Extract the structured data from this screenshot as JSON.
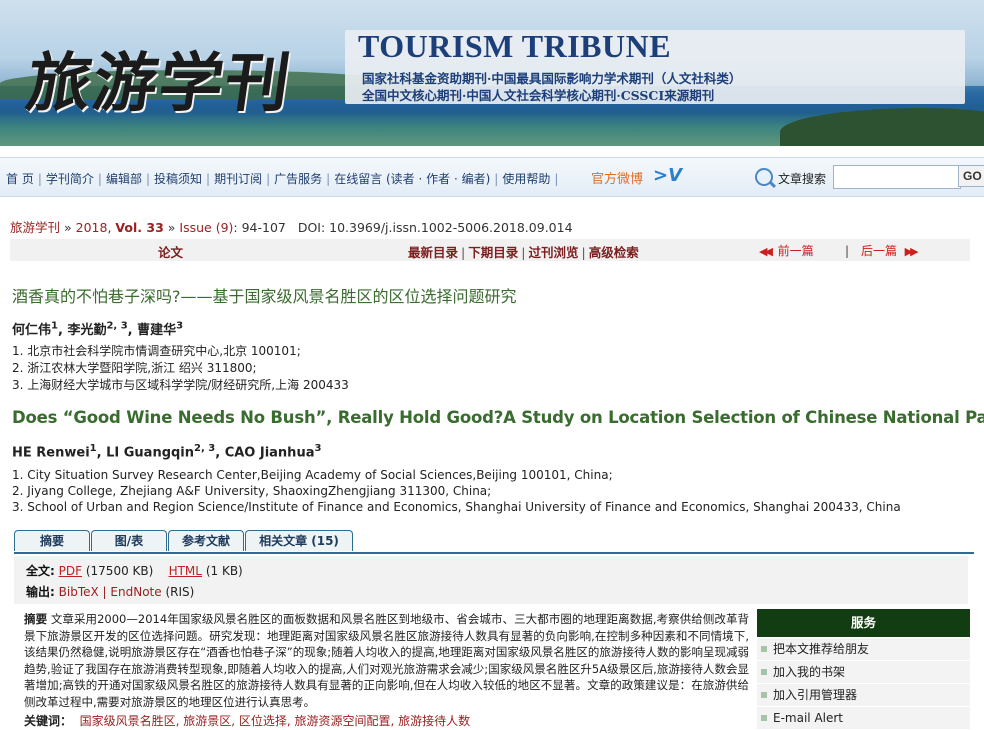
{
  "banner": {
    "calligraphy": "旅游学刊",
    "title_en": "TOURISM TRIBUNE",
    "line1": "国家社科基金资助期刊·中国最具国际影响力学术期刊（人文社科类）",
    "line2": "全国中文核心期刊·中国人文社会科学核心期刊·CSSCI来源期刊"
  },
  "nav": {
    "items": [
      "首 页",
      "学刊简介",
      "编辑部",
      "投稿须知",
      "期刊订阅",
      "广告服务",
      "在线留言 (读者 · 作者 · 编者)",
      "使用帮助"
    ],
    "weibo": "官方微博",
    "search_label": "文章搜索",
    "search_value": "",
    "search_button": "GO"
  },
  "citation": {
    "journal": "旅游学刊",
    "sep": "»",
    "year": "2018",
    "volume": "Vol. 33",
    "issue": "Issue (9)",
    "pages": ": 94-107",
    "doi": "DOI: 10.3969/j.issn.1002-5006.2018.09.014"
  },
  "toolbar": {
    "section": "论文",
    "links": [
      "最新目录",
      "下期目录",
      "过刊浏览",
      "高级检索"
    ],
    "prev": "前一篇",
    "next": "后一篇",
    "divider": "|"
  },
  "article": {
    "title_cn": "酒香真的不怕巷子深吗?——基于国家级风景名胜区的区位选择问题研究",
    "authors_cn": [
      {
        "name": "何仁伟",
        "sup": "1"
      },
      {
        "name": "李光勤",
        "sup": "2, 3"
      },
      {
        "name": "曹建华",
        "sup": "3"
      }
    ],
    "aff_cn": [
      "1. 北京市社会科学院市情调查研究中心,北京  100101;",
      "2. 浙江农林大学暨阳学院,浙江  绍兴  311800;",
      "3. 上海财经大学城市与区域科学学院/财经研究所,上海  200433"
    ],
    "title_en": "Does “Good Wine Needs No Bush”, Really Hold Good?A Study on Location Selection of Chinese National Parks",
    "authors_en": [
      {
        "name": "HE Renwei",
        "sup": "1"
      },
      {
        "name": "LI Guangqin",
        "sup": "2, 3"
      },
      {
        "name": "CAO Jianhua",
        "sup": "3"
      }
    ],
    "aff_en": [
      "1. City Situation Survey Research Center,Beijing Academy of Social Sciences,Beijing 100101, China;",
      "2. Jiyang College, Zhejiang A&F University, ShaoxingZhengjiang 311300, China;",
      "3. School of Urban and Region Science/Institute of Finance and Economics, Shanghai University of Finance and Economics, Shanghai 200433, China"
    ]
  },
  "tabs": [
    "摘要",
    "图/表",
    "参考文献",
    "相关文章 (15)"
  ],
  "fulltext": {
    "label": "全文:",
    "pdf": "PDF",
    "pdf_size": "(17500 KB)",
    "html": "HTML",
    "html_size": "(1 KB)",
    "export_label": "输出:",
    "bibtex": "BibTeX",
    "sep": "|",
    "endnote": "EndNote",
    "ris": "(RIS)"
  },
  "abstract": {
    "label": "摘要",
    "text": "文章采用2000—2014年国家级风景名胜区的面板数据和风景名胜区到地级市、省会城市、三大都市圈的地理距离数据,考察供给侧改革背景下旅游景区开发的区位选择问题。研究发现：地理距离对国家级风景名胜区旅游接待人数具有显著的负向影响,在控制多种因素和不同情境下,该结果仍然稳健,说明旅游景区存在“酒香也怕巷子深”的现象;随着人均收入的提高,地理距离对国家级风景名胜区的旅游接待人数的影响呈现减弱趋势,验证了我国存在旅游消费转型现象,即随着人均收入的提高,人们对观光旅游需求会减少;国家级风景名胜区升5A级景区后,旅游接待人数会显著增加;高铁的开通对国家级风景名胜区的旅游接待人数具有显著的正向影响,但在人均收入较低的地区不显著。文章的政策建议是：在旅游供给侧改革过程中,需要对旅游景区的地理区位进行认真思考。",
    "keywords_label": "关键词：",
    "keywords": "国家级风景名胜区, 旅游景区, 区位选择, 旅游资源空间配置, 旅游接待人数"
  },
  "service": {
    "title": "服务",
    "items": [
      "把本文推荐给朋友",
      "加入我的书架",
      "加入引用管理器",
      "E-mail Alert"
    ]
  }
}
